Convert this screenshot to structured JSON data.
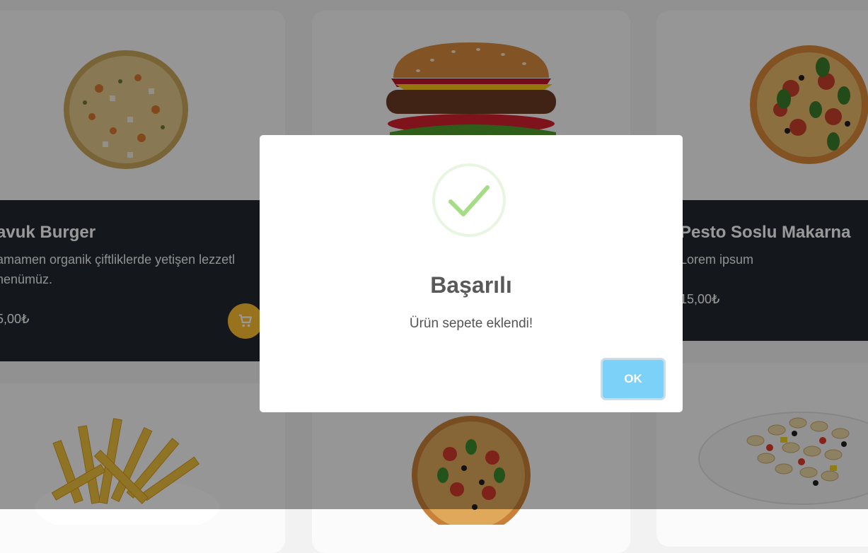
{
  "products": [
    {
      "name": "avuk Burger",
      "desc_line1": "amamen organik çiftliklerde yetişen lezzetl",
      "desc_line2": "nenümüz.",
      "price": "5,00₺",
      "cart_icon": "cart-icon",
      "image": "pizza-image"
    },
    {
      "name": "Pesto Soslu Makarna",
      "desc_line1": "Lorem ipsum",
      "price": "15,00₺",
      "image": "pizza-image"
    }
  ],
  "modal": {
    "icon": "success-check-icon",
    "title": "Başarılı",
    "text": "Ürün sepete eklendi!",
    "ok_label": "OK"
  },
  "colors": {
    "card_dark": "#222831",
    "cart_button": "#ffbe33",
    "ok_button": "#7cd1f9",
    "success_green": "#a5dc86"
  }
}
